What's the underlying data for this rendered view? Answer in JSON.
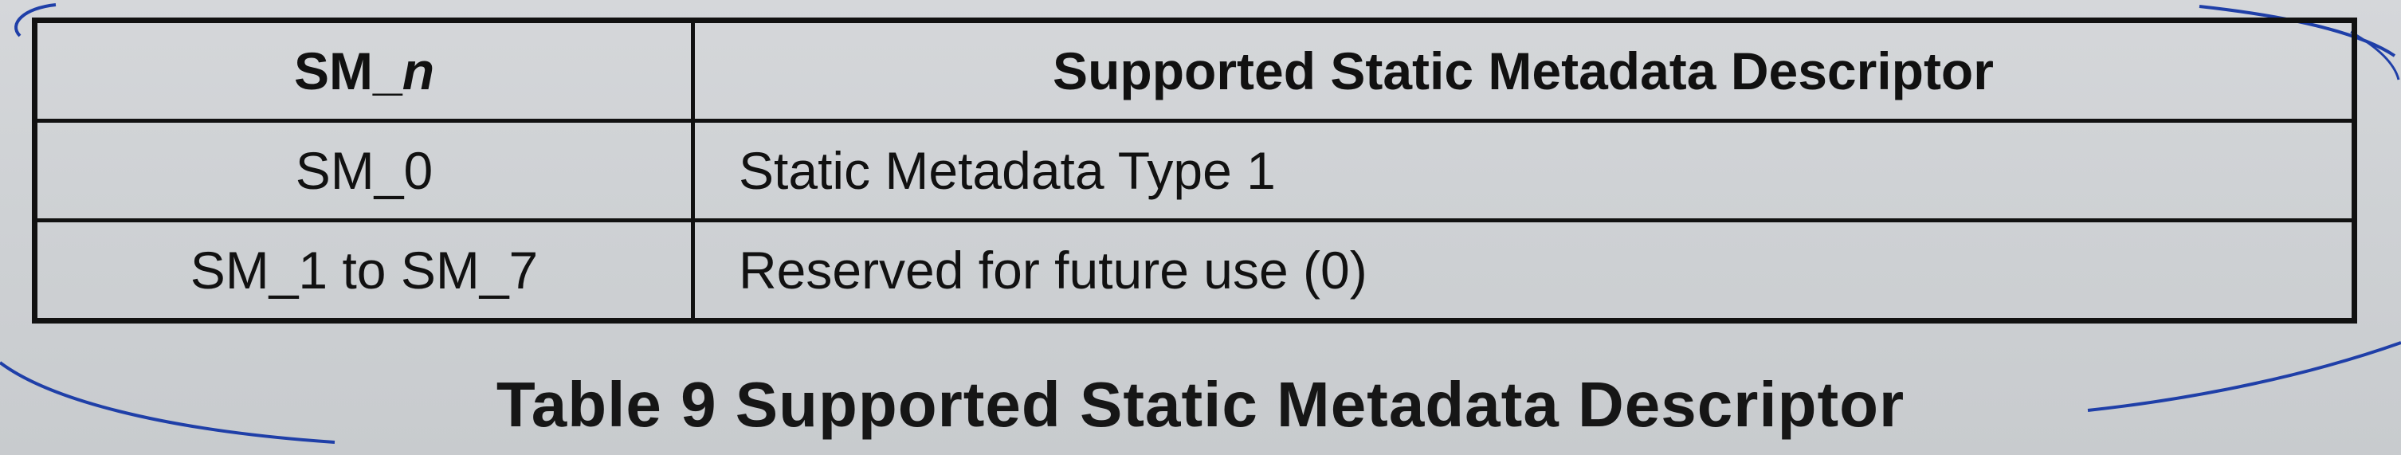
{
  "table": {
    "header": {
      "col1_prefix": "SM_",
      "col1_var": "n",
      "col2": "Supported Static Metadata Descriptor"
    },
    "rows": [
      {
        "sm": "SM_0",
        "descriptor": "Static Metadata Type 1"
      },
      {
        "sm": "SM_1 to SM_7",
        "descriptor": "Reserved for future use (0)"
      }
    ]
  },
  "caption": "Table 9 Supported Static Metadata Descriptor",
  "colors": {
    "paper": "#cfd2d5",
    "ink": "#111111",
    "pen": "#1f3fa8"
  }
}
